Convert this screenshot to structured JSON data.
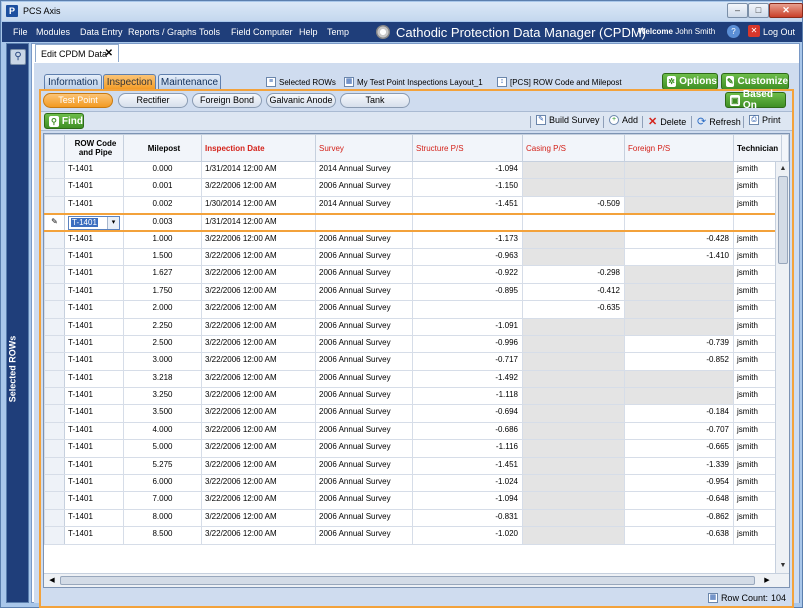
{
  "window": {
    "title": "PCS Axis",
    "min": "–",
    "max": "□",
    "close": "✕"
  },
  "menu": {
    "items": [
      "File",
      "Modules",
      "Data Entry",
      "Reports / Graphs",
      "Tools",
      "Field Computer",
      "Help",
      "Temp"
    ],
    "app_title": "Cathodic Protection Data Manager (CPDM)",
    "welcome_label": "Welcome",
    "user": "John Smith",
    "logout": "Log Out"
  },
  "sidebar": {
    "label": "Selected ROWs"
  },
  "doc_tab": {
    "label": "Edit CPDM Data",
    "close": "✕"
  },
  "main_tabs": [
    "Information",
    "Inspection",
    "Maintenance"
  ],
  "header_tools": {
    "selected_rows": "Selected ROWs",
    "layout": "My Test Point Inspections Layout_1",
    "sort": "[PCS] ROW Code and Milepost"
  },
  "buttons": {
    "options": "Options",
    "customize": "Customize",
    "based_on": "Based On",
    "find": "Find"
  },
  "sub_tabs": [
    "Test Point",
    "Rectifier",
    "Foreign Bond",
    "Galvanic Anode",
    "Tank"
  ],
  "toolbar": {
    "build_survey": "Build Survey",
    "add": "Add",
    "delete": "Delete",
    "refresh": "Refresh",
    "print": "Print"
  },
  "grid": {
    "columns": [
      "ROW Code and Pipe",
      "Milepost",
      "Inspection Date",
      "Survey",
      "Structure P/S",
      "Casing P/S",
      "Foreign P/S",
      "Technician"
    ],
    "rows": [
      [
        "T-1401",
        "0.000",
        "1/31/2014 12:00 AM",
        "2014 Annual Survey",
        "-1.094",
        "",
        "",
        "jsmith"
      ],
      [
        "T-1401",
        "0.001",
        "3/22/2006 12:00 AM",
        "2006 Annual Survey",
        "-1.150",
        "",
        "",
        "jsmith"
      ],
      [
        "T-1401",
        "0.002",
        "1/30/2014 12:00 AM",
        "2014 Annual Survey",
        "-1.451",
        "-0.509",
        "",
        "jsmith"
      ],
      [
        "T-1401",
        "0.003",
        "1/31/2014 12:00 AM",
        "",
        "",
        "",
        "",
        ""
      ],
      [
        "T-1401",
        "1.000",
        "3/22/2006 12:00 AM",
        "2006 Annual Survey",
        "-1.173",
        "",
        "-0.428",
        "jsmith"
      ],
      [
        "T-1401",
        "1.500",
        "3/22/2006 12:00 AM",
        "2006 Annual Survey",
        "-0.963",
        "",
        "-1.410",
        "jsmith"
      ],
      [
        "T-1401",
        "1.627",
        "3/22/2006 12:00 AM",
        "2006 Annual Survey",
        "-0.922",
        "-0.298",
        "",
        "jsmith"
      ],
      [
        "T-1401",
        "1.750",
        "3/22/2006 12:00 AM",
        "2006 Annual Survey",
        "-0.895",
        "-0.412",
        "",
        "jsmith"
      ],
      [
        "T-1401",
        "2.000",
        "3/22/2006 12:00 AM",
        "2006 Annual Survey",
        "",
        "-0.635",
        "",
        "jsmith"
      ],
      [
        "T-1401",
        "2.250",
        "3/22/2006 12:00 AM",
        "2006 Annual Survey",
        "-1.091",
        "",
        "",
        "jsmith"
      ],
      [
        "T-1401",
        "2.500",
        "3/22/2006 12:00 AM",
        "2006 Annual Survey",
        "-0.996",
        "",
        "-0.739",
        "jsmith"
      ],
      [
        "T-1401",
        "3.000",
        "3/22/2006 12:00 AM",
        "2006 Annual Survey",
        "-0.717",
        "",
        "-0.852",
        "jsmith"
      ],
      [
        "T-1401",
        "3.218",
        "3/22/2006 12:00 AM",
        "2006 Annual Survey",
        "-1.492",
        "",
        "",
        "jsmith"
      ],
      [
        "T-1401",
        "3.250",
        "3/22/2006 12:00 AM",
        "2006 Annual Survey",
        "-1.118",
        "",
        "",
        "jsmith"
      ],
      [
        "T-1401",
        "3.500",
        "3/22/2006 12:00 AM",
        "2006 Annual Survey",
        "-0.694",
        "",
        "-0.184",
        "jsmith"
      ],
      [
        "T-1401",
        "4.000",
        "3/22/2006 12:00 AM",
        "2006 Annual Survey",
        "-0.686",
        "",
        "-0.707",
        "jsmith"
      ],
      [
        "T-1401",
        "5.000",
        "3/22/2006 12:00 AM",
        "2006 Annual Survey",
        "-1.116",
        "",
        "-0.665",
        "jsmith"
      ],
      [
        "T-1401",
        "5.275",
        "3/22/2006 12:00 AM",
        "2006 Annual Survey",
        "-1.451",
        "",
        "-1.339",
        "jsmith"
      ],
      [
        "T-1401",
        "6.000",
        "3/22/2006 12:00 AM",
        "2006 Annual Survey",
        "-1.024",
        "",
        "-0.954",
        "jsmith"
      ],
      [
        "T-1401",
        "7.000",
        "3/22/2006 12:00 AM",
        "2006 Annual Survey",
        "-1.094",
        "",
        "-0.648",
        "jsmith"
      ],
      [
        "T-1401",
        "8.000",
        "3/22/2006 12:00 AM",
        "2006 Annual Survey",
        "-0.831",
        "",
        "-0.862",
        "jsmith"
      ],
      [
        "T-1401",
        "8.500",
        "3/22/2006 12:00 AM",
        "2006 Annual Survey",
        "-1.020",
        "",
        "-0.638",
        "jsmith"
      ]
    ],
    "gray_cells": [
      [
        0,
        5
      ],
      [
        0,
        6
      ],
      [
        1,
        5
      ],
      [
        1,
        6
      ],
      [
        2,
        6
      ],
      [
        3,
        5
      ],
      [
        3,
        6
      ],
      [
        4,
        5
      ],
      [
        5,
        5
      ],
      [
        6,
        6
      ],
      [
        7,
        6
      ],
      [
        8,
        6
      ],
      [
        9,
        5
      ],
      [
        9,
        6
      ],
      [
        10,
        5
      ],
      [
        11,
        5
      ],
      [
        12,
        5
      ],
      [
        12,
        6
      ],
      [
        13,
        5
      ],
      [
        13,
        6
      ],
      [
        14,
        5
      ],
      [
        15,
        5
      ],
      [
        16,
        5
      ],
      [
        17,
        5
      ],
      [
        18,
        5
      ],
      [
        19,
        5
      ],
      [
        20,
        5
      ],
      [
        21,
        5
      ]
    ]
  },
  "status": {
    "row_count_label": "Row Count:",
    "row_count": "104"
  }
}
